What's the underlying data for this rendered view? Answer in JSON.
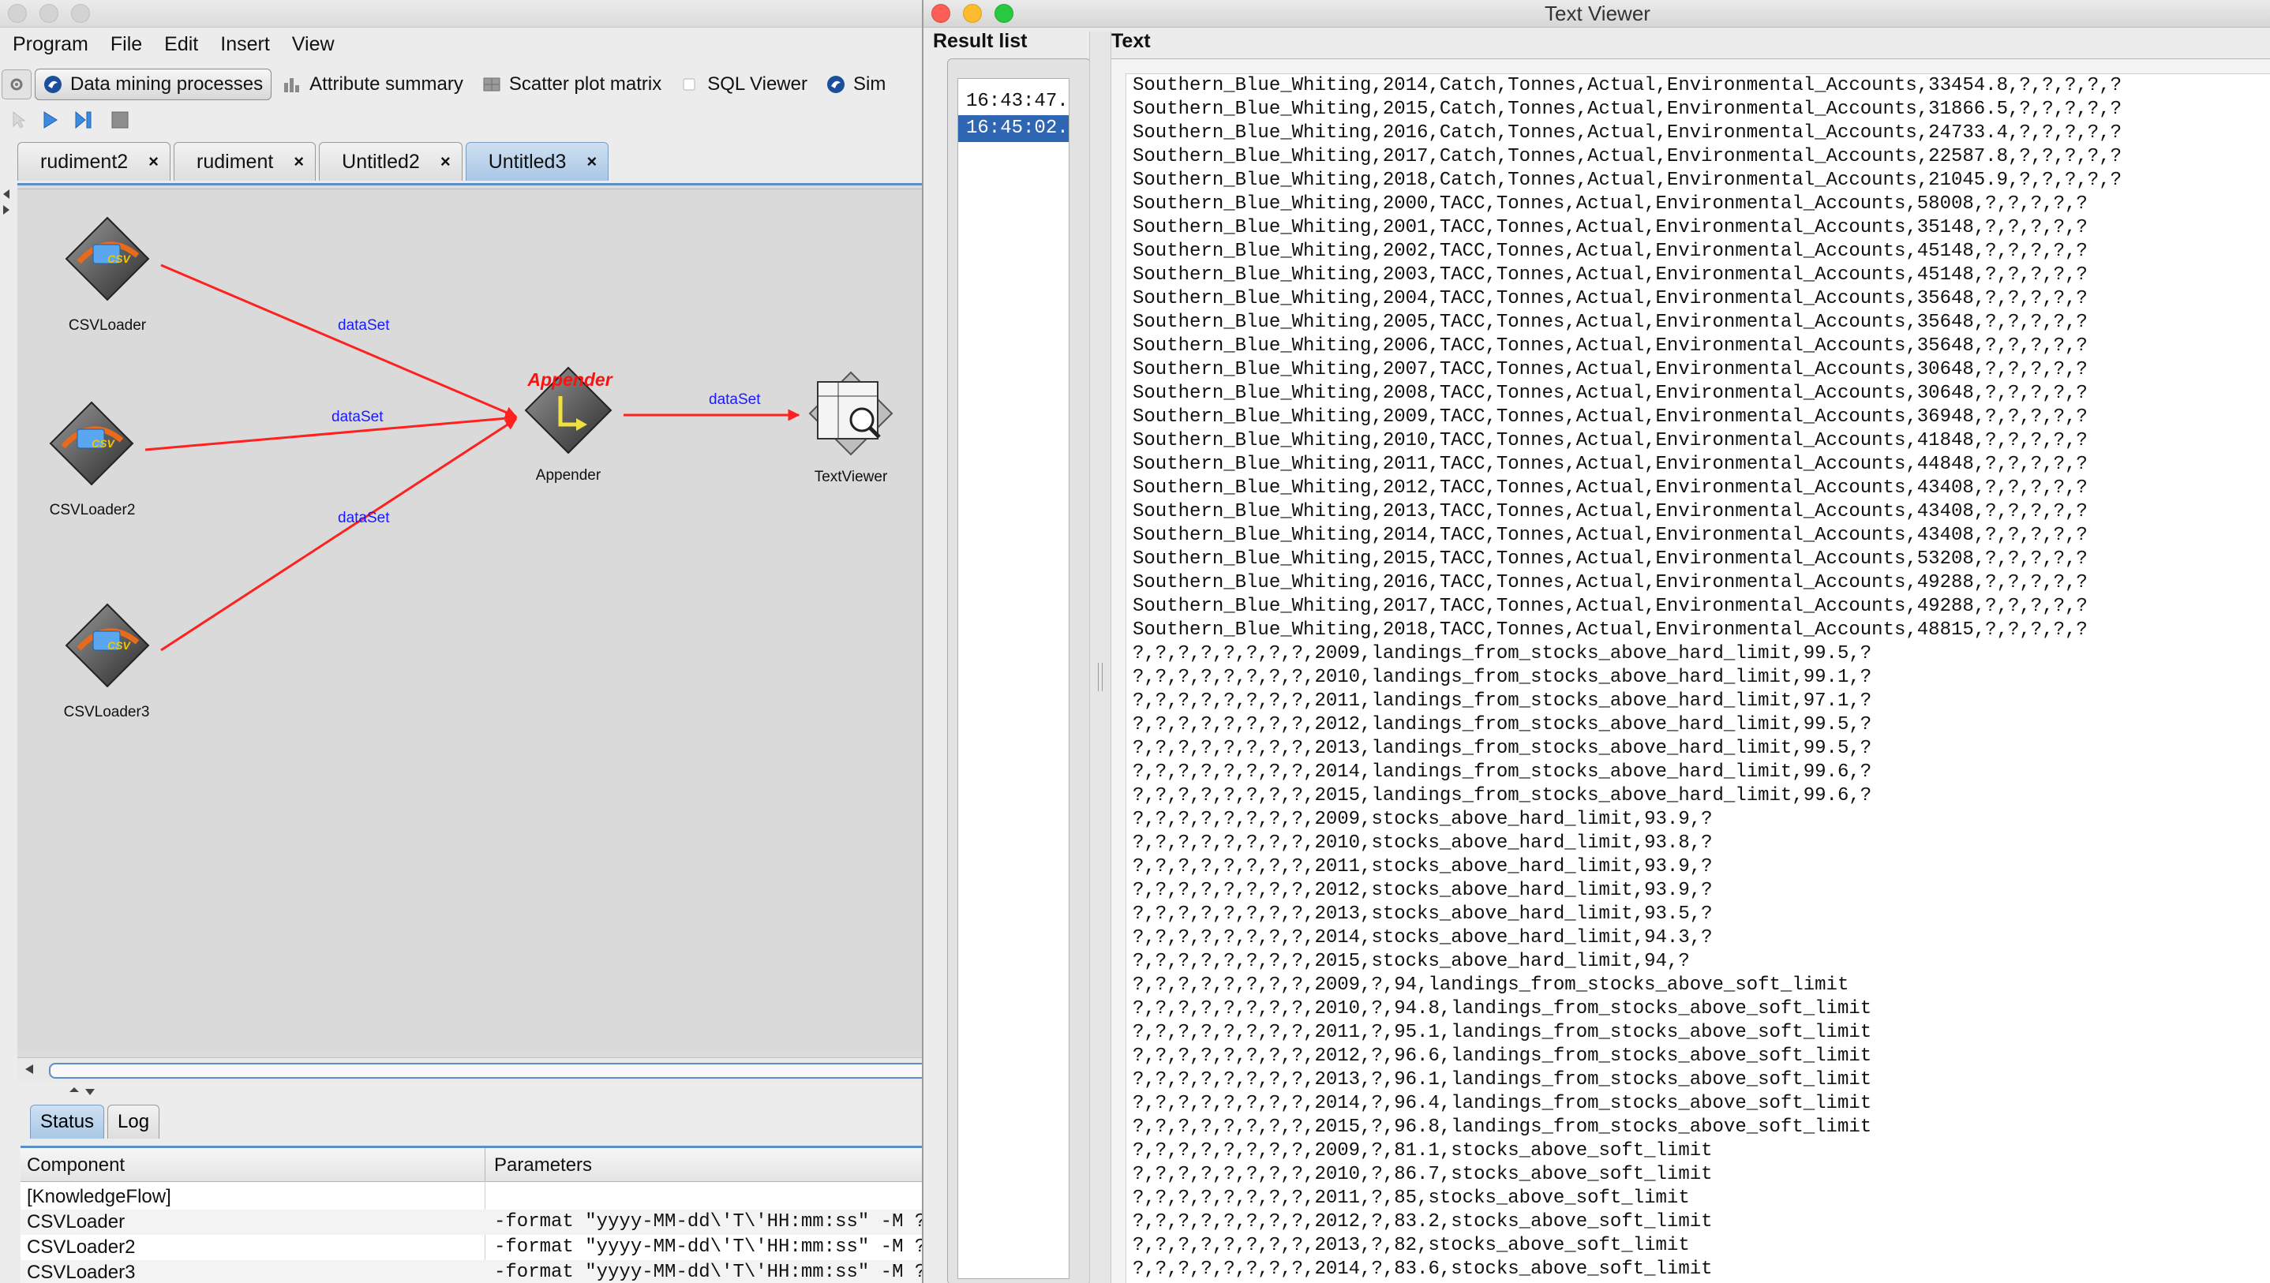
{
  "menubar": [
    "Program",
    "File",
    "Edit",
    "Insert",
    "View"
  ],
  "proc_tabs": [
    {
      "label": "Data mining processes",
      "icon": "weka-bird-icon",
      "active": true
    },
    {
      "label": "Attribute summary",
      "icon": "bar-chart-icon",
      "active": false
    },
    {
      "label": "Scatter plot matrix",
      "icon": "scatter-grid-icon",
      "active": false
    },
    {
      "label": "SQL Viewer",
      "icon": "checkbox-icon",
      "active": false
    },
    {
      "label": "Sim",
      "icon": "weka-bird-icon",
      "active": false
    }
  ],
  "flow_tabs": [
    {
      "label": "rudiment2",
      "active": false
    },
    {
      "label": "rudiment",
      "active": false
    },
    {
      "label": "Untitled2",
      "active": false
    },
    {
      "label": "Untitled3",
      "active": true
    }
  ],
  "close_glyph": "×",
  "nodes": {
    "csv1": "CSVLoader",
    "csv2": "CSVLoader2",
    "csv3": "CSVLoader3",
    "appender": "Appender",
    "appender_banner": "Appender",
    "textviewer": "TextViewer",
    "csv_badge": "CSV"
  },
  "edges": {
    "e1": "dataSet",
    "e2": "dataSet",
    "e3": "dataSet",
    "e4": "dataSet"
  },
  "status": {
    "tabs": [
      {
        "label": "Status",
        "active": true
      },
      {
        "label": "Log",
        "active": false
      }
    ],
    "columns": [
      "Component",
      "Parameters"
    ],
    "rows": [
      {
        "component": "[KnowledgeFlow]",
        "params": ""
      },
      {
        "component": "CSVLoader",
        "params": "-format \"yyyy-MM-dd\\'T\\'HH:mm:ss\" -M ? -B"
      },
      {
        "component": "CSVLoader2",
        "params": "-format \"yyyy-MM-dd\\'T\\'HH:mm:ss\" -M ? -B"
      },
      {
        "component": "CSVLoader3",
        "params": "-format \"yyyy-MM-dd\\'T\\'HH:mm:ss\" -M ? -B"
      }
    ]
  },
  "text_viewer": {
    "title": "Text Viewer",
    "result_list_label": "Result list",
    "results": [
      {
        "label": "16:43:47.",
        "selected": false
      },
      {
        "label": "16:45:02.",
        "selected": true
      }
    ],
    "text_label": "Text",
    "lines": [
      "Southern_Blue_Whiting,2014,Catch,Tonnes,Actual,Environmental_Accounts,33454.8,?,?,?,?,?",
      "Southern_Blue_Whiting,2015,Catch,Tonnes,Actual,Environmental_Accounts,31866.5,?,?,?,?,?",
      "Southern_Blue_Whiting,2016,Catch,Tonnes,Actual,Environmental_Accounts,24733.4,?,?,?,?,?",
      "Southern_Blue_Whiting,2017,Catch,Tonnes,Actual,Environmental_Accounts,22587.8,?,?,?,?,?",
      "Southern_Blue_Whiting,2018,Catch,Tonnes,Actual,Environmental_Accounts,21045.9,?,?,?,?,?",
      "Southern_Blue_Whiting,2000,TACC,Tonnes,Actual,Environmental_Accounts,58008,?,?,?,?,?",
      "Southern_Blue_Whiting,2001,TACC,Tonnes,Actual,Environmental_Accounts,35148,?,?,?,?,?",
      "Southern_Blue_Whiting,2002,TACC,Tonnes,Actual,Environmental_Accounts,45148,?,?,?,?,?",
      "Southern_Blue_Whiting,2003,TACC,Tonnes,Actual,Environmental_Accounts,45148,?,?,?,?,?",
      "Southern_Blue_Whiting,2004,TACC,Tonnes,Actual,Environmental_Accounts,35648,?,?,?,?,?",
      "Southern_Blue_Whiting,2005,TACC,Tonnes,Actual,Environmental_Accounts,35648,?,?,?,?,?",
      "Southern_Blue_Whiting,2006,TACC,Tonnes,Actual,Environmental_Accounts,35648,?,?,?,?,?",
      "Southern_Blue_Whiting,2007,TACC,Tonnes,Actual,Environmental_Accounts,30648,?,?,?,?,?",
      "Southern_Blue_Whiting,2008,TACC,Tonnes,Actual,Environmental_Accounts,30648,?,?,?,?,?",
      "Southern_Blue_Whiting,2009,TACC,Tonnes,Actual,Environmental_Accounts,36948,?,?,?,?,?",
      "Southern_Blue_Whiting,2010,TACC,Tonnes,Actual,Environmental_Accounts,41848,?,?,?,?,?",
      "Southern_Blue_Whiting,2011,TACC,Tonnes,Actual,Environmental_Accounts,44848,?,?,?,?,?",
      "Southern_Blue_Whiting,2012,TACC,Tonnes,Actual,Environmental_Accounts,43408,?,?,?,?,?",
      "Southern_Blue_Whiting,2013,TACC,Tonnes,Actual,Environmental_Accounts,43408,?,?,?,?,?",
      "Southern_Blue_Whiting,2014,TACC,Tonnes,Actual,Environmental_Accounts,43408,?,?,?,?,?",
      "Southern_Blue_Whiting,2015,TACC,Tonnes,Actual,Environmental_Accounts,53208,?,?,?,?,?",
      "Southern_Blue_Whiting,2016,TACC,Tonnes,Actual,Environmental_Accounts,49288,?,?,?,?,?",
      "Southern_Blue_Whiting,2017,TACC,Tonnes,Actual,Environmental_Accounts,49288,?,?,?,?,?",
      "Southern_Blue_Whiting,2018,TACC,Tonnes,Actual,Environmental_Accounts,48815,?,?,?,?,?",
      "?,?,?,?,?,?,?,?,2009,landings_from_stocks_above_hard_limit,99.5,?",
      "?,?,?,?,?,?,?,?,2010,landings_from_stocks_above_hard_limit,99.1,?",
      "?,?,?,?,?,?,?,?,2011,landings_from_stocks_above_hard_limit,97.1,?",
      "?,?,?,?,?,?,?,?,2012,landings_from_stocks_above_hard_limit,99.5,?",
      "?,?,?,?,?,?,?,?,2013,landings_from_stocks_above_hard_limit,99.5,?",
      "?,?,?,?,?,?,?,?,2014,landings_from_stocks_above_hard_limit,99.6,?",
      "?,?,?,?,?,?,?,?,2015,landings_from_stocks_above_hard_limit,99.6,?",
      "?,?,?,?,?,?,?,?,2009,stocks_above_hard_limit,93.9,?",
      "?,?,?,?,?,?,?,?,2010,stocks_above_hard_limit,93.8,?",
      "?,?,?,?,?,?,?,?,2011,stocks_above_hard_limit,93.9,?",
      "?,?,?,?,?,?,?,?,2012,stocks_above_hard_limit,93.9,?",
      "?,?,?,?,?,?,?,?,2013,stocks_above_hard_limit,93.5,?",
      "?,?,?,?,?,?,?,?,2014,stocks_above_hard_limit,94.3,?",
      "?,?,?,?,?,?,?,?,2015,stocks_above_hard_limit,94,?",
      "?,?,?,?,?,?,?,?,2009,?,94,landings_from_stocks_above_soft_limit",
      "?,?,?,?,?,?,?,?,2010,?,94.8,landings_from_stocks_above_soft_limit",
      "?,?,?,?,?,?,?,?,2011,?,95.1,landings_from_stocks_above_soft_limit",
      "?,?,?,?,?,?,?,?,2012,?,96.6,landings_from_stocks_above_soft_limit",
      "?,?,?,?,?,?,?,?,2013,?,96.1,landings_from_stocks_above_soft_limit",
      "?,?,?,?,?,?,?,?,2014,?,96.4,landings_from_stocks_above_soft_limit",
      "?,?,?,?,?,?,?,?,2015,?,96.8,landings_from_stocks_above_soft_limit",
      "?,?,?,?,?,?,?,?,2009,?,81.1,stocks_above_soft_limit",
      "?,?,?,?,?,?,?,?,2010,?,86.7,stocks_above_soft_limit",
      "?,?,?,?,?,?,?,?,2011,?,85,stocks_above_soft_limit",
      "?,?,?,?,?,?,?,?,2012,?,83.2,stocks_above_soft_limit",
      "?,?,?,?,?,?,?,?,2013,?,82,stocks_above_soft_limit",
      "?,?,?,?,?,?,?,?,2014,?,83.6,stocks_above_soft_limit"
    ]
  },
  "colors": {
    "edge": "#ff2020",
    "edge_label": "#1a1aff",
    "selection": "#2f66b3",
    "tab_accent": "#5d8fc4",
    "close_light": "#fc5f57",
    "minimize_light": "#fdbc2e",
    "zoom_light": "#28c940"
  }
}
